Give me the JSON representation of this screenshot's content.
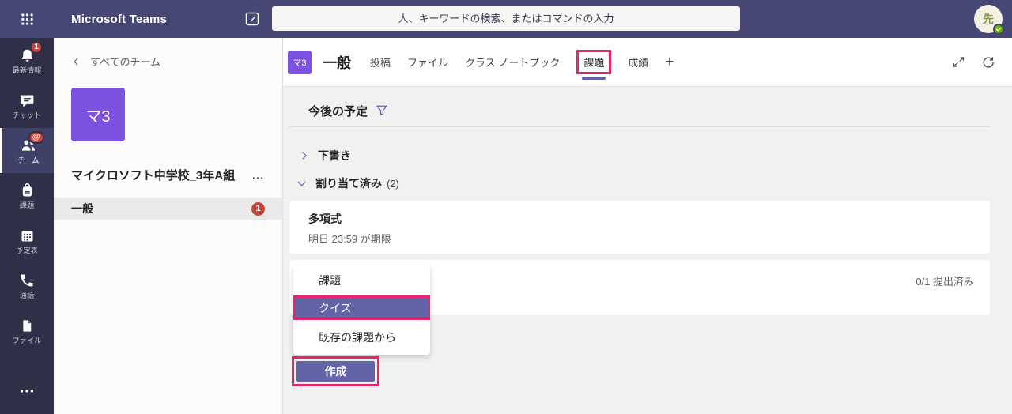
{
  "colors": {
    "topbar_purple": "#464775",
    "rail_navy": "#2f3048",
    "accent_purple": "#6264a7",
    "avatar_purple": "#7c52e0",
    "annotation_pink": "#e5256e",
    "badge_red": "#c4453b",
    "presence_green": "#6bb700",
    "content_gray": "#f2f1f0"
  },
  "topbar": {
    "app_title": "Microsoft Teams",
    "search_placeholder": "人、キーワードの検索、またはコマンドの入力",
    "avatar_initial": "先"
  },
  "rail": {
    "items": [
      {
        "label": "最新情報",
        "badge": "1"
      },
      {
        "label": "チャット"
      },
      {
        "label": "チーム",
        "badge": "@"
      },
      {
        "label": "課題"
      },
      {
        "label": "予定表"
      },
      {
        "label": "通話"
      },
      {
        "label": "ファイル"
      }
    ]
  },
  "sidebar": {
    "back_label": "すべてのチーム",
    "team_avatar_text": "マ3",
    "team_name": "マイクロソフト中学校_3年A組",
    "team_more": "…",
    "channel": {
      "name": "一般",
      "badge": "1"
    }
  },
  "main": {
    "channel_avatar_text": "マ3",
    "channel_title": "一般",
    "tabs": [
      {
        "label": "投稿"
      },
      {
        "label": "ファイル"
      },
      {
        "label": "クラス ノートブック"
      },
      {
        "label": "課題",
        "active": true
      },
      {
        "label": "成績"
      },
      {
        "label": "+"
      }
    ]
  },
  "content": {
    "upcoming_title": "今後の予定",
    "sections": [
      {
        "label": "下書き",
        "state": "collapsed"
      },
      {
        "label": "割り当て済み",
        "count": "(2)",
        "state": "expanded"
      }
    ],
    "assignments": [
      {
        "title": "多項式",
        "due": "明日 23:59 が期限"
      },
      {
        "submitted": "0/1 提出済み"
      }
    ],
    "create_menu": {
      "items": [
        {
          "label": "課題"
        },
        {
          "label": "クイズ",
          "highlighted": true
        },
        {
          "label": "既存の課題から"
        }
      ],
      "create_label": "作成"
    }
  }
}
